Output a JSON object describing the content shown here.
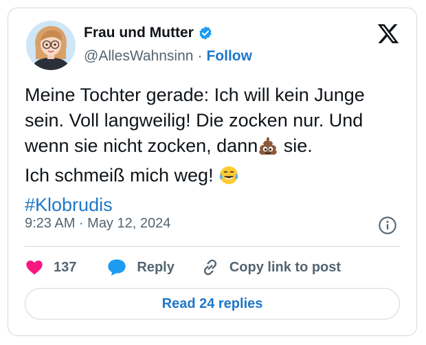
{
  "author": {
    "display_name": "Frau und Mutter",
    "handle": "@AllesWahnsinn",
    "separator": "·",
    "follow_label": "Follow"
  },
  "tweet": {
    "line1": "Meine Tochter gerade: Ich will kein Junge",
    "line2": "sein. Voll langweilig! Die zocken nur. Und",
    "line3_a": "wenn sie nicht zocken, dann",
    "line3_emoji": "pile-of-poo-emoji",
    "line3_b": " sie.",
    "line4": "Ich schmeiß mich weg! ",
    "line4_emoji": "tears-of-joy-emoji",
    "hashtag": "#Klobrudis"
  },
  "meta": {
    "timestamp": "9:23 AM · May 12, 2024"
  },
  "actions": {
    "likes_count": "137",
    "reply_label": "Reply",
    "copy_label": "Copy link to post"
  },
  "footer": {
    "read_replies_label": "Read 24 replies"
  },
  "icons": {
    "brand": "x-logo-icon",
    "verified": "verified-badge-icon",
    "info": "info-icon",
    "like": "heart-icon",
    "reply": "chat-bubble-icon",
    "link": "link-icon"
  },
  "colors": {
    "link_blue": "#1d77c9",
    "heart_pink": "#f91880",
    "reply_blue": "#1d9bf0",
    "muted_text": "#536471",
    "border": "#cfd9de"
  }
}
